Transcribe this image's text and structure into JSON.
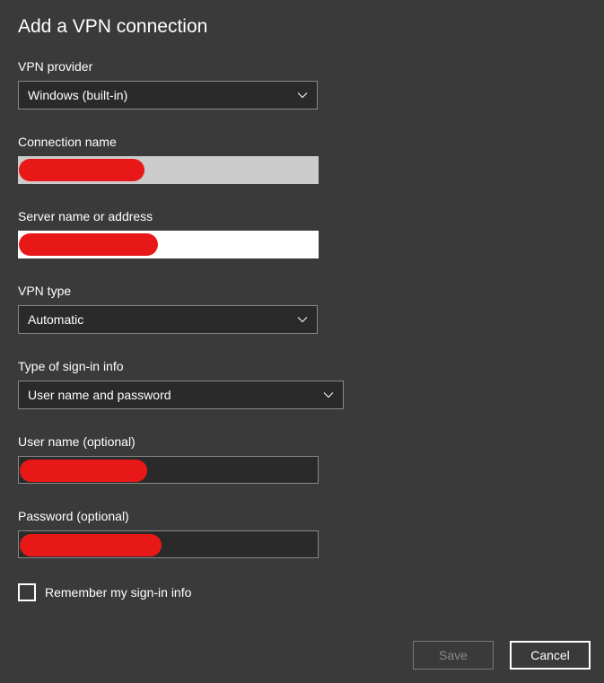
{
  "title": "Add a VPN connection",
  "fields": {
    "provider": {
      "label": "VPN provider",
      "value": "Windows (built-in)"
    },
    "connectionName": {
      "label": "Connection name",
      "value": "",
      "redactedWidth": 140,
      "redactedHeight": 25
    },
    "serverAddress": {
      "label": "Server name or address",
      "value": "",
      "redactedWidth": 155,
      "redactedHeight": 25
    },
    "vpnType": {
      "label": "VPN type",
      "value": "Automatic"
    },
    "signinType": {
      "label": "Type of sign-in info",
      "value": "User name and password"
    },
    "username": {
      "label": "User name (optional)",
      "value": "",
      "redactedWidth": 142,
      "redactedHeight": 25
    },
    "password": {
      "label": "Password (optional)",
      "value": "",
      "redactedWidth": 158,
      "redactedHeight": 25
    }
  },
  "checkbox": {
    "label": "Remember my sign-in info",
    "checked": false
  },
  "buttons": {
    "save": "Save",
    "cancel": "Cancel"
  }
}
